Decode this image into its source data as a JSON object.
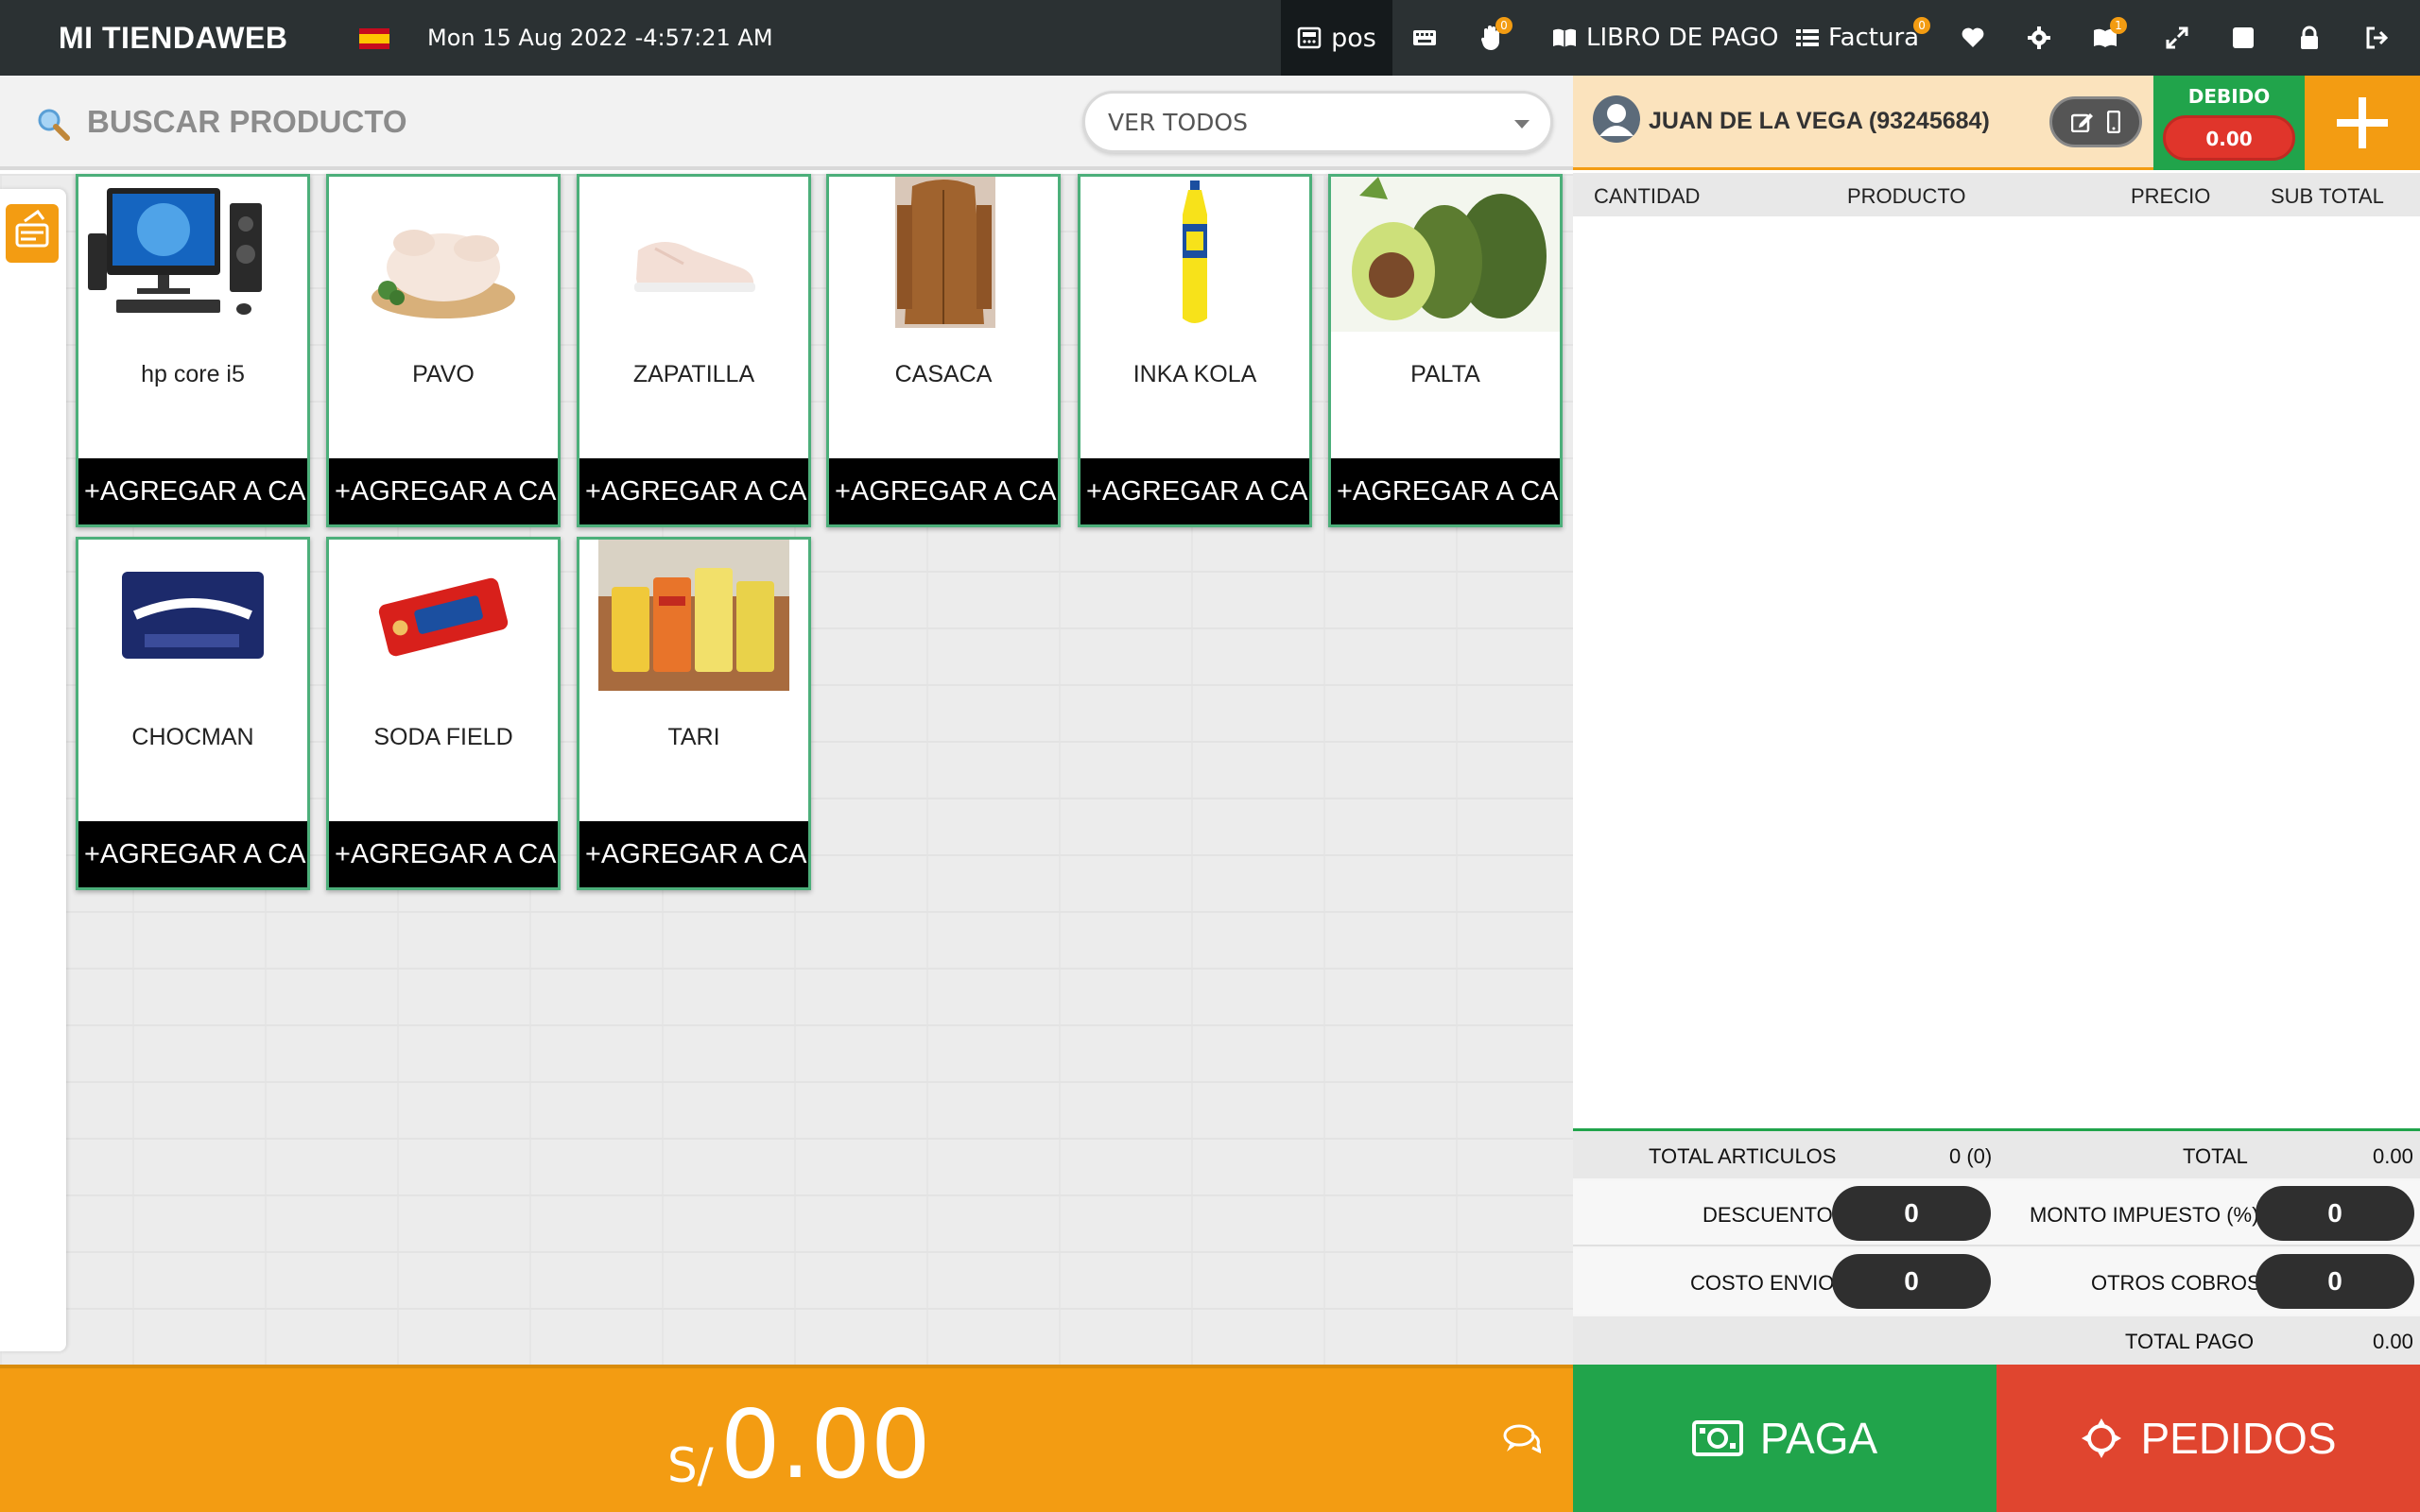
{
  "topbar": {
    "brand": "MI TIENDAWEB",
    "datetime": "Mon 15 Aug 2022 -4:57:21 AM",
    "pos_label": "pos",
    "libro_label": "LIBRO DE PAGO",
    "factura_label": "Factura",
    "badge_hand": "0",
    "badge_factura": "0",
    "badge_notify": "1",
    "icons": [
      "keyboard-icon",
      "hand-icon",
      "book-icon",
      "list-icon",
      "heart-icon",
      "gear-icon",
      "bell-icon",
      "expand-icon",
      "square-icon",
      "lock-icon",
      "logout-icon"
    ]
  },
  "search": {
    "label": "BUSCAR PRODUCTO",
    "filter_value": "VER TODOS"
  },
  "products": [
    {
      "name": "hp core i5",
      "button": "+AGREGAR A CARRITO"
    },
    {
      "name": "PAVO",
      "button": "+AGREGAR A CARRITO"
    },
    {
      "name": "ZAPATILLA",
      "button": "+AGREGAR A CARRITO"
    },
    {
      "name": "CASACA",
      "button": "+AGREGAR A CARRITO"
    },
    {
      "name": "INKA KOLA",
      "button": "+AGREGAR A CARRITO"
    },
    {
      "name": "PALTA",
      "button": "+AGREGAR A CARRITO"
    },
    {
      "name": "CHOCMAN",
      "button": "+AGREGAR A CARRITO"
    },
    {
      "name": "SODA FIELD",
      "button": "+AGREGAR A CARRITO"
    },
    {
      "name": "TARI",
      "button": "+AGREGAR A CARRITO"
    }
  ],
  "customer": {
    "name": "JUAN DE LA VEGA (93245684)",
    "debit_label": "DEBIDO",
    "debit_value": "0.00"
  },
  "cart": {
    "columns": [
      "CANTIDAD",
      "PRODUCTO",
      "PRECIO",
      "SUB TOTAL"
    ]
  },
  "totals": {
    "items_label": "TOTAL ARTICULOS",
    "items_value": "0 (0)",
    "total_label": "TOTAL",
    "total_value": "0.00",
    "discount_label": "DESCUENTO",
    "discount_value": "0",
    "tax_label": "MONTO IMPUESTO (%)",
    "tax_value": "0",
    "shipping_label": "COSTO ENVIO",
    "shipping_value": "0",
    "other_label": "OTROS COBROS",
    "other_value": "0",
    "payment_label": "TOTAL PAGO",
    "payment_value": "0.00"
  },
  "footer": {
    "currency": "S/",
    "amount": "0.00",
    "pay_label": "PAGA",
    "orders_label": "PEDIDOS"
  },
  "colors": {
    "topbar": "#2b3133",
    "accent_orange": "#f39c12",
    "green": "#21a44b",
    "red": "#e0452f"
  }
}
